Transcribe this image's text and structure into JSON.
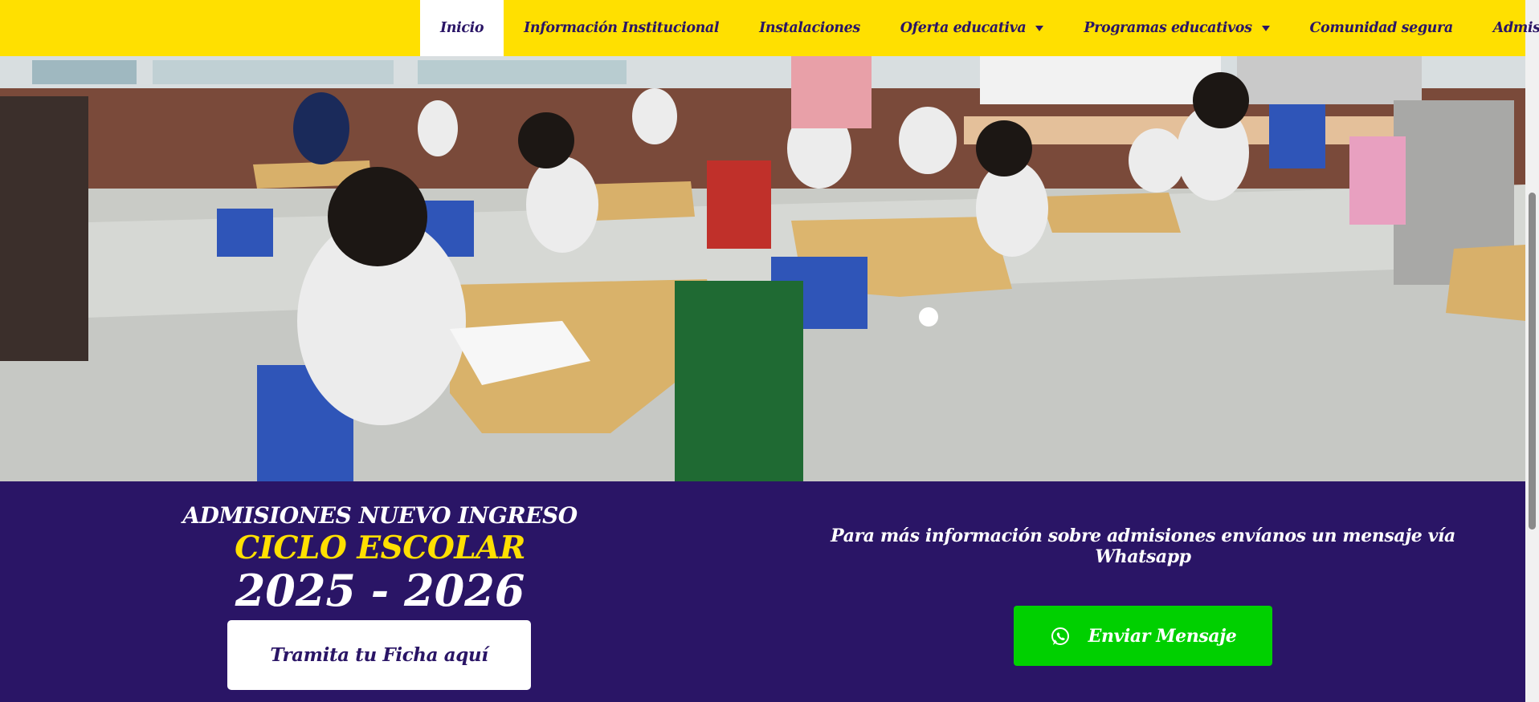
{
  "nav": {
    "items": [
      {
        "label": "Inicio",
        "active": true,
        "dropdown": false
      },
      {
        "label": "Información Institucional",
        "active": false,
        "dropdown": false
      },
      {
        "label": "Instalaciones",
        "active": false,
        "dropdown": false
      },
      {
        "label": "Oferta educativa",
        "active": false,
        "dropdown": true
      },
      {
        "label": "Programas educativos",
        "active": false,
        "dropdown": true
      },
      {
        "label": "Comunidad segura",
        "active": false,
        "dropdown": false
      },
      {
        "label": "Admisiones",
        "active": false,
        "dropdown": true
      }
    ]
  },
  "hero": {
    "image": "classroom-photo",
    "slide_indicator": "slider-dot"
  },
  "admissions": {
    "line1": "ADMISIONES NUEVO INGRESO",
    "line2": "CICLO ESCOLAR",
    "line3": "2025 - 2026",
    "cta_label": "Tramita tu Ficha aquí"
  },
  "contact": {
    "info_text": "Para más información sobre admisiones envíanos un mensaje vía Whatsapp",
    "whatsapp_label": "Enviar Mensaje",
    "whatsapp_icon": "whatsapp-icon"
  },
  "colors": {
    "nav_bg": "#ffe000",
    "brand_purple": "#2a1566",
    "accent_yellow": "#ffe000",
    "whatsapp_green": "#00d000"
  }
}
